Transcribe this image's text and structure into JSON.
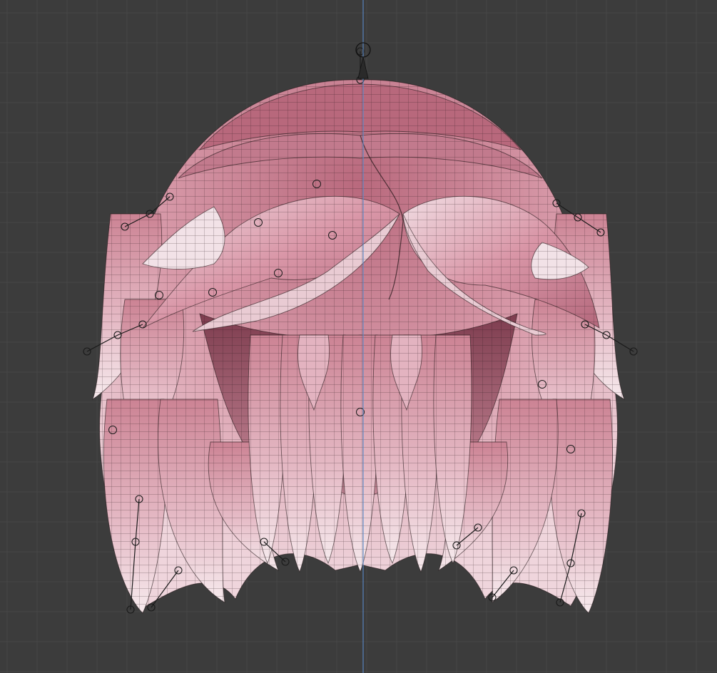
{
  "viewport": {
    "kind": "3d-viewport-orthographic-front",
    "colors": {
      "background": "#3c3c3c",
      "grid_minor": "#464646",
      "grid_major": "#4e4e4e",
      "z_axis": "#5b8ac8",
      "hair_base": "#d89aa9",
      "hair_dark": "#8e4a5c",
      "hair_light": "#f4e6ea",
      "wire": "#1f1416",
      "rig": "#1a1a1a"
    }
  },
  "model": {
    "mesh": "hair-mesh",
    "shading": "solid-with-wireframe-overlay"
  },
  "rig": {
    "icons": [
      "bone-joint-icon",
      "hook-empty-icon"
    ]
  }
}
